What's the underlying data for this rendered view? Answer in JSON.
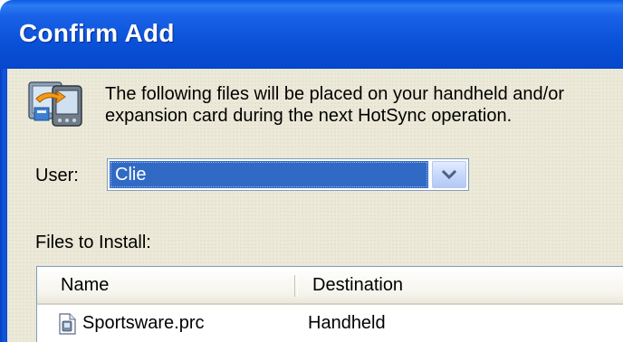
{
  "window": {
    "title": "Confirm Add"
  },
  "intro": {
    "icon": "hotsync-install-icon",
    "line1": "The following files will be placed on your handheld and/or",
    "line2": "expansion card during the next HotSync operation."
  },
  "user": {
    "label": "User:",
    "selected": "Clie",
    "dropdown_icon": "chevron-down-icon"
  },
  "files": {
    "label": "Files to Install:",
    "columns": [
      "Name",
      "Destination"
    ],
    "rows": [
      {
        "name": "Sportsware.prc",
        "destination": "Handheld",
        "icon": "prc-file-icon"
      }
    ]
  },
  "colors": {
    "titlebar": "#0a52d8",
    "client_bg": "#ece9d8",
    "selection": "#316ac5"
  }
}
